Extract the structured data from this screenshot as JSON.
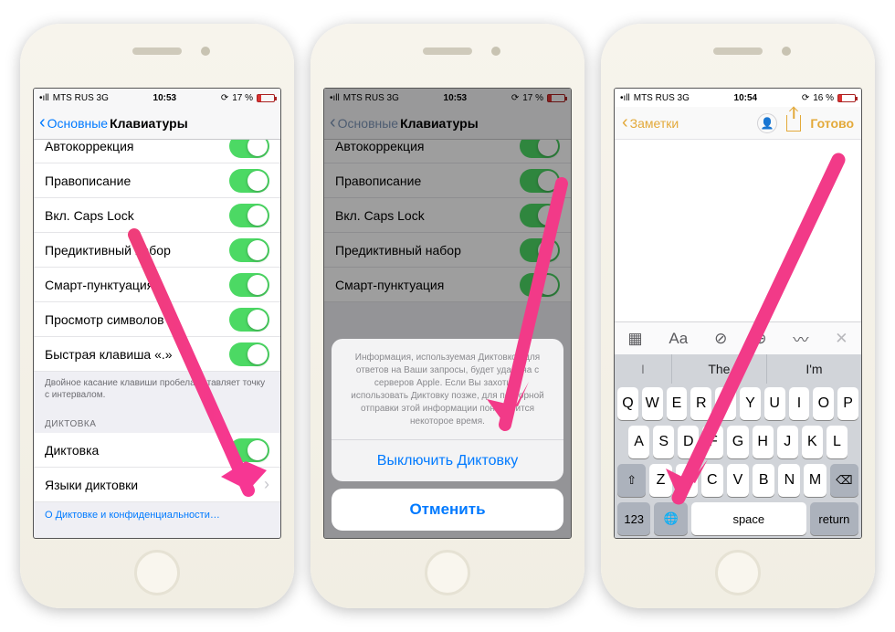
{
  "status": {
    "carrier": "MTS RUS  3G",
    "battery_pct": "17 %",
    "battery_pct3": "16 %"
  },
  "times": [
    "10:53",
    "10:53",
    "10:54"
  ],
  "nav": {
    "back": "Основные",
    "title": "Клавиатуры"
  },
  "rows": {
    "autocorrect": "Автокоррекция",
    "spelling": "Правописание",
    "capslock": "Вкл. Caps Lock",
    "predictive": "Предиктивный набор",
    "smartpunct": "Смарт-пунктуация",
    "charpreview": "Просмотр символов",
    "shortcut": "Быстрая клавиша «.»",
    "dictation": "Диктовка",
    "dictlangs": "Языки диктовки"
  },
  "footer_note": "Двойное касание клавиши пробела вставляет точку с интервалом.",
  "section_dict": "ДИКТОВКА",
  "dict_link": "О Диктовке и конфиденциальности…",
  "sheet": {
    "text": "Информация, используемая Диктовкой для ответов на Ваши запросы, будет удалена с серверов Apple. Если Вы захотите использовать Диктовку позже, для повторной отправки этой информации понадобится некоторое время.",
    "action": "Выключить Диктовку",
    "cancel": "Отменить"
  },
  "notes": {
    "back": "Заметки",
    "done": "Готово"
  },
  "suggestions": [
    "I",
    "The",
    "I'm"
  ],
  "kb": {
    "r1": [
      "Q",
      "W",
      "E",
      "R",
      "T",
      "Y",
      "U",
      "I",
      "O",
      "P"
    ],
    "r2": [
      "A",
      "S",
      "D",
      "F",
      "G",
      "H",
      "J",
      "K",
      "L"
    ],
    "r3": [
      "Z",
      "X",
      "C",
      "V",
      "B",
      "N",
      "M"
    ],
    "numkey": "123",
    "space": "space",
    "return": "return"
  },
  "toolbar_aa": "Aa"
}
